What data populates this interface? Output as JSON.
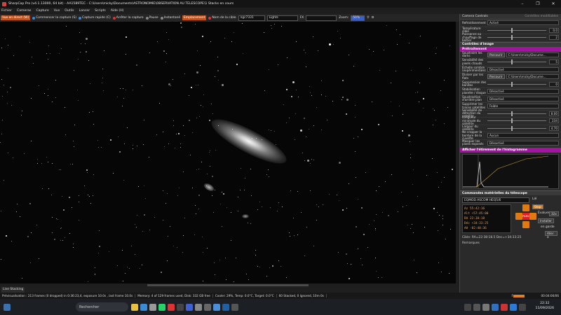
{
  "window": {
    "title": "SharpCap Pro (v4.1.13000, 64 bit) - AA1589TEC - C:\\Users\\micky\\Documents\\ASTRONOMIE\\OBSERVATION AU TELESCOPE\\1 Stacks en cours",
    "controls": [
      "–",
      "❐",
      "✕"
    ]
  },
  "menu": [
    "Fichier",
    "Cameras",
    "Capture",
    "Vue",
    "Outils",
    "Lancer",
    "Scripts",
    "Aide (H)"
  ],
  "toolbar": {
    "live_view": "Vue en direct (W)",
    "start_capture": "Commencer la capture (S)",
    "quick_capture": "Capture rapide (C)",
    "stop_capture": "Arrêter la capture",
    "pause": "Pause",
    "snapshot": "Instantané",
    "pin": "Emplacement",
    "target_label": "Nom de la cible",
    "target_value": "ngc7331",
    "frame_type": "Lights",
    "fx_label": "FX",
    "zoom_label": "Zoom:",
    "zoom_value": "50%"
  },
  "tabs": {
    "live_stacking": "Live Stacking"
  },
  "status": {
    "previewing": "Prévisualisation : 213 frames (0 dropped) in 0:36:23,4, exposure 10.0s , last frame 10.0s",
    "memory": "Memory: 4 of 129 frames used, Disk: 332 GB free",
    "cooler": "Cooler: 29%, Temp: 0.0°C, Target: 0.0°C",
    "stacked": "60 Stacked, 0 Ignored, 10m 0s",
    "fps_label": "Fsense:",
    "time": "00:04:06/06"
  },
  "panel": {
    "header": "Camera Controls",
    "options_label": "Contrôles modifiables",
    "top_rows": [
      {
        "label": "Refroidissement",
        "value": "Activé"
      },
      {
        "label": "Température cible",
        "value": "0.0"
      },
      {
        "label": "Puissance ou chauffage de boîtier",
        "value": "2"
      }
    ],
    "image_controls": "Contrôles d'image",
    "preprocessing": "Prétraitement",
    "pre_rows": [
      {
        "label": "Soustraire les darks",
        "btn": "Parcourir",
        "value": "C:\\Users\\micky\\Docume..."
      },
      {
        "label": "Sensibilité des pixels chauds",
        "value": "5"
      },
      {
        "label": "Échelle sombre (expérimentale)",
        "value": "Désactivé"
      },
      {
        "label": "Diviser par les flats",
        "btn": "Parcourir",
        "value": "C:\\Users\\micky\\Docume..."
      },
      {
        "label": "Suppression des bandes",
        "value": "0"
      },
      {
        "label": "Stabilisation planète / disque",
        "value": "Désactivé"
      },
      {
        "label": "Soustraction d'arrière plan",
        "value": "Désactivé"
      },
      {
        "label": "Supprimer les traces satellites",
        "value": "Faible"
      },
      {
        "label": "Sensibilité de détection du satellite",
        "value": "8.00"
      },
      {
        "label": "Longueur minimale du satellite",
        "value": "234"
      },
      {
        "label": "Largeur du satellite",
        "value": "4.70"
      },
      {
        "label": "Ne cropper la bordure de la cuvette",
        "value": "Aucun"
      },
      {
        "label": "Masquer les pixels exposés",
        "value": "Désactivé"
      }
    ],
    "histogram": "Afficher l'étirement de l'histogramme",
    "scope_header": "Commandes matérielles du télescope",
    "scope_name": "EQMOD ASCOM HEQ5/6",
    "scope_connected": "Lié",
    "coords": {
      "az": "55:42:16",
      "alt": "+57:45:00",
      "ra": "22:38:18",
      "dec": "+34:33:25",
      "ah": "-02:40:36"
    },
    "coord_labels": {
      "az": "Az",
      "alt": "Alt",
      "ra": "RA",
      "dec": "Déc",
      "ah": "AH"
    },
    "park": "PARK",
    "stop": "Stop",
    "track_label": "Évaluer",
    "track_rate": "32x",
    "install": "Installer",
    "ensure": "en garde",
    "go_label": "Aller à",
    "target": "Cible:  RA=22:38:18.5 Dec=+34:33:25",
    "remarks": "Remarques"
  },
  "taskbar": {
    "search": "Rechercher",
    "time": "22:32",
    "date": "11/09/2026"
  },
  "colors": {
    "accent": "#e07a10",
    "magenta": "#a0149e"
  }
}
